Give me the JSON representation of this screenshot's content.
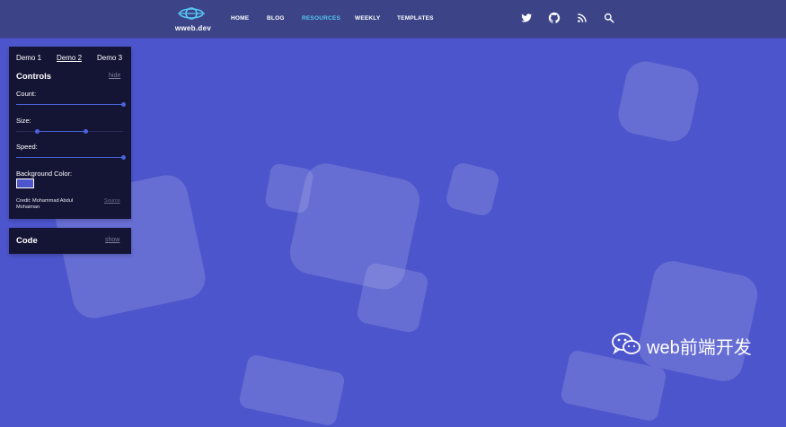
{
  "header": {
    "brand": "wweb.dev",
    "nav": [
      {
        "label": "HOME",
        "active": false
      },
      {
        "label": "BLOG",
        "active": false
      },
      {
        "label": "RESOURCES",
        "active": true
      },
      {
        "label": "WEEKLY",
        "active": false
      },
      {
        "label": "TEMPLATES",
        "active": false
      }
    ],
    "icons": [
      "twitter-icon",
      "github-icon",
      "rss-icon",
      "search-icon"
    ]
  },
  "controls": {
    "tabs": [
      {
        "label": "Demo 1",
        "selected": false
      },
      {
        "label": "Demo 2",
        "selected": true
      },
      {
        "label": "Demo 3",
        "selected": false
      }
    ],
    "title": "Controls",
    "hide_label": "hide",
    "count_label": "Count:",
    "size_label": "Size:",
    "speed_label": "Speed:",
    "bg_label": "Background Color:",
    "count_value": 1.0,
    "size_range": [
      0.2,
      0.65
    ],
    "speed_value": 1.0,
    "background_color": "#4d55cc",
    "credit": "Credit: Mohammad Abdul Mohaiman",
    "source_label": "Source"
  },
  "code_panel": {
    "title": "Code",
    "show_label": "show"
  },
  "colors": {
    "background": "#4d55cc",
    "header": "#3c4487",
    "panel": "#141535",
    "accent": "#56c6f3",
    "slider": "#4a63d8"
  },
  "watermark": {
    "text": "web前端开发"
  }
}
